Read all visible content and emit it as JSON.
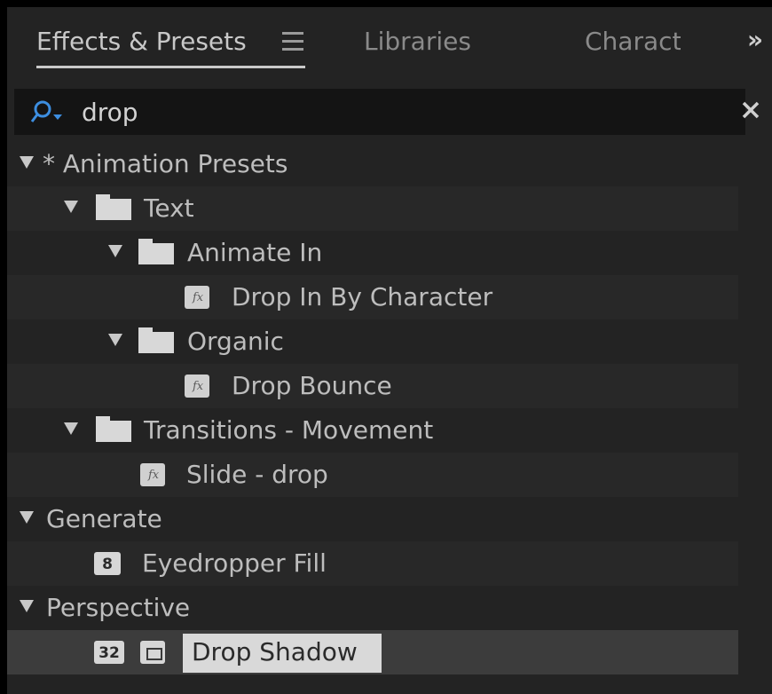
{
  "tabs": {
    "effects_label": "Effects & Presets",
    "libraries_label": "Libraries",
    "character_label": "Charact",
    "overflow_label": "»"
  },
  "search": {
    "value": "drop"
  },
  "tree": {
    "animation_presets": "* Animation Presets",
    "text": "Text",
    "animate_in": "Animate In",
    "drop_in_by_character": "Drop In By Character",
    "organic": "Organic",
    "drop_bounce": "Drop Bounce",
    "transitions_movement": "Transitions - Movement",
    "slide_drop": "Slide - drop",
    "generate": "Generate",
    "eyedropper_badge": "8",
    "eyedropper_fill": "Eyedropper Fill",
    "perspective": "Perspective",
    "drop_shadow_badge": "32",
    "drop_shadow": "Drop Shadow"
  },
  "icons": {
    "search": "search-icon",
    "clear": "close-icon",
    "folder": "folder-icon",
    "preset": "fx-preset-icon",
    "gpu": "gpu-accelerated-icon"
  },
  "colors": {
    "panel_bg": "#232323",
    "search_accent": "#3d8ee0",
    "selection": "#d9d9d9"
  }
}
